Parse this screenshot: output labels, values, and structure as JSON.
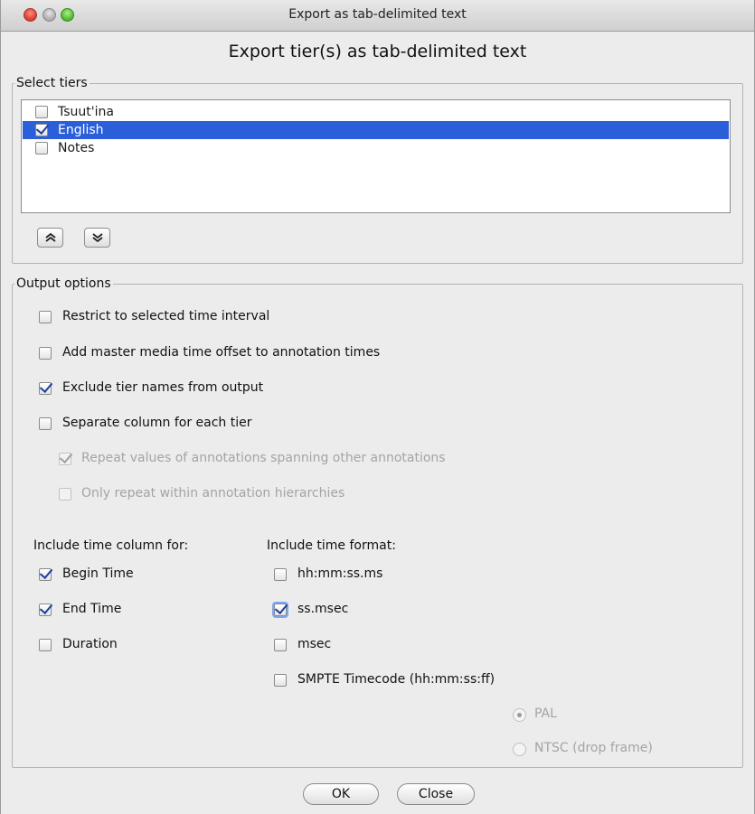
{
  "window": {
    "title": "Export as tab-delimited text"
  },
  "dialog": {
    "heading": "Export tier(s) as tab-delimited text"
  },
  "select_tiers": {
    "legend": "Select tiers",
    "tiers": [
      {
        "label": "Tsuut'ina",
        "checked": false,
        "selected": false
      },
      {
        "label": "English",
        "checked": true,
        "selected": true
      },
      {
        "label": "Notes",
        "checked": false,
        "selected": false
      }
    ],
    "move_up_icon": "chevron-double-up-icon",
    "move_down_icon": "chevron-double-down-icon"
  },
  "output_options": {
    "legend": "Output options",
    "restrict_interval": "Restrict to selected time interval",
    "add_offset": "Add master media time offset to annotation times",
    "exclude_tier_names": "Exclude tier names from output",
    "separate_column": "Separate column for each tier",
    "repeat_values": "Repeat values of annotations spanning other annotations",
    "only_repeat": "Only repeat within annotation hierarchies",
    "time_column_heading": "Include time column for:",
    "begin_time": "Begin Time",
    "end_time": "End Time",
    "duration": "Duration",
    "time_format_heading": "Include time format:",
    "hhmmss": "hh:mm:ss.ms",
    "ssmsec": "ss.msec",
    "msec": "msec",
    "smpte": "SMPTE Timecode (hh:mm:ss:ff)",
    "pal": "PAL",
    "ntsc": "NTSC (drop frame)"
  },
  "buttons": {
    "ok": "OK",
    "close": "Close"
  },
  "colors": {
    "selection": "#2b5fd9",
    "checkmark": "#1d3f9a"
  }
}
